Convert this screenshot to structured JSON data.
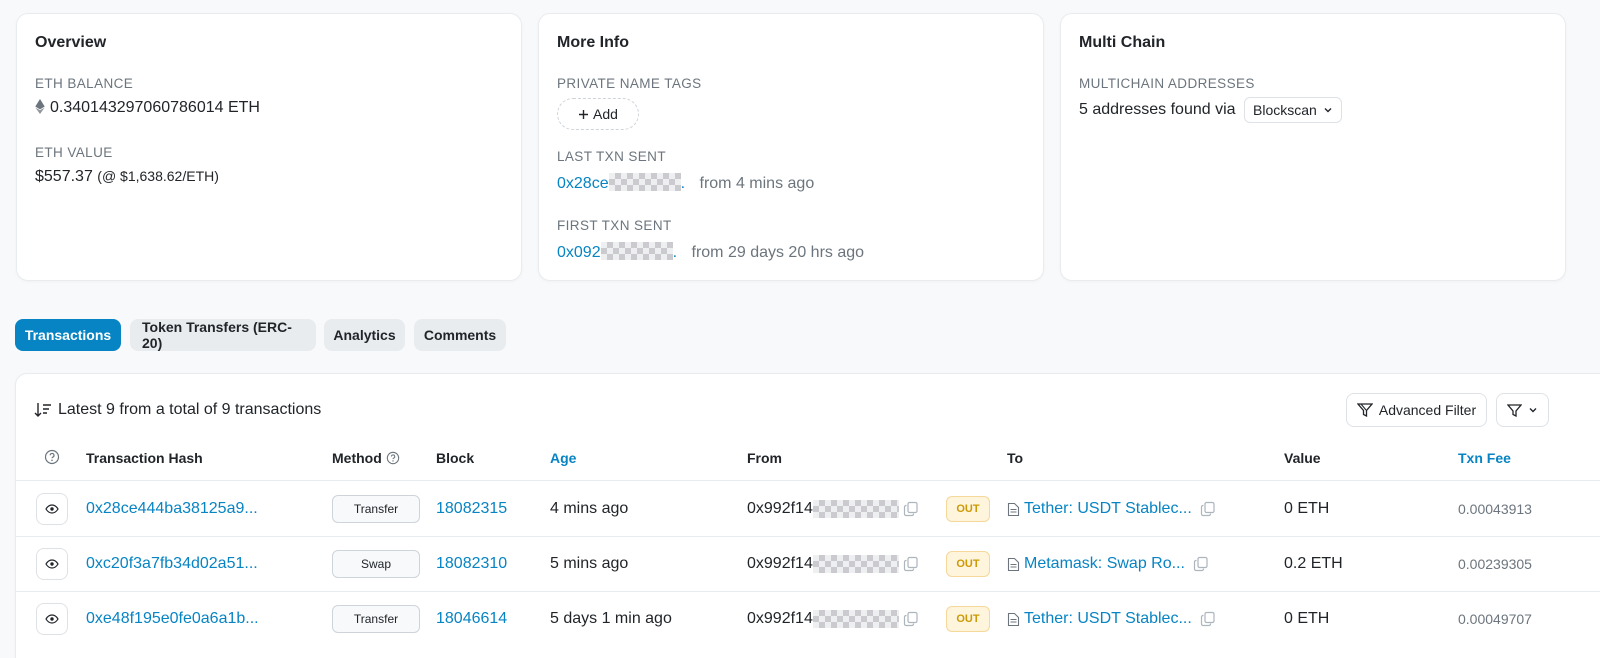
{
  "overview": {
    "title": "Overview",
    "eth_balance_label": "ETH BALANCE",
    "eth_balance": "0.340143297060786014 ETH",
    "eth_value_label": "ETH VALUE",
    "eth_value": "$557.37",
    "eth_rate": "(@ $1,638.62/ETH)"
  },
  "more_info": {
    "title": "More Info",
    "private_tags_label": "PRIVATE NAME TAGS",
    "add_label": "Add",
    "last_txn_label": "LAST TXN SENT",
    "last_txn_hash": "0x28ce",
    "last_txn_ellipsis": ".",
    "last_txn_when": "from 4 mins ago",
    "first_txn_label": "FIRST TXN SENT",
    "first_txn_hash": "0x092",
    "first_txn_ellipsis": ".",
    "first_txn_when": "from 29 days 20 hrs ago"
  },
  "multichain": {
    "title": "Multi Chain",
    "label": "MULTICHAIN ADDRESSES",
    "text": "5 addresses found via",
    "dropdown": "Blockscan"
  },
  "tabs": [
    {
      "label": "Transactions",
      "active": true
    },
    {
      "label": "Token Transfers (ERC-20)",
      "active": false
    },
    {
      "label": "Analytics",
      "active": false
    },
    {
      "label": "Comments",
      "active": false
    }
  ],
  "table": {
    "summary": "Latest 9 from a total of 9 transactions",
    "advanced_filter_label": "Advanced Filter",
    "headers": {
      "hash": "Transaction Hash",
      "method": "Method",
      "block": "Block",
      "age": "Age",
      "from": "From",
      "to": "To",
      "value": "Value",
      "fee": "Txn Fee"
    },
    "rows": [
      {
        "hash": "0x28ce444ba38125a9...",
        "method": "Transfer",
        "block": "18082315",
        "age": "4 mins ago",
        "from": "0x992f14",
        "direction": "OUT",
        "to": "Tether: USDT Stablec...",
        "value": "0 ETH",
        "fee": "0.00043913"
      },
      {
        "hash": "0xc20f3a7fb34d02a51...",
        "method": "Swap",
        "block": "18082310",
        "age": "5 mins ago",
        "from": "0x992f14",
        "direction": "OUT",
        "to": "Metamask: Swap Ro...",
        "value": "0.2 ETH",
        "fee": "0.00239305"
      },
      {
        "hash": "0xe48f195e0fe0a6a1b...",
        "method": "Transfer",
        "block": "18046614",
        "age": "5 days 1 min ago",
        "from": "0x992f14",
        "direction": "OUT",
        "to": "Tether: USDT Stablec...",
        "value": "0 ETH",
        "fee": "0.00049707"
      }
    ]
  },
  "colors": {
    "accent": "#0784c3",
    "out_badge_bg": "#fff4dc",
    "out_badge_text": "#cc9a06"
  }
}
